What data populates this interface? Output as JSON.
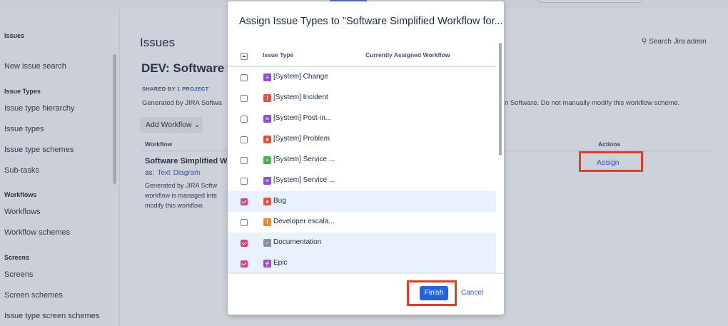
{
  "sidebar": {
    "items": [
      {
        "label": "Issues",
        "header": true
      },
      {
        "label": "New issue search",
        "header": false
      },
      {
        "label": "Issue Types",
        "header": true
      },
      {
        "label": "Issue type hierarchy",
        "header": false
      },
      {
        "label": "Issue types",
        "header": false
      },
      {
        "label": "Issue type schemes",
        "header": false
      },
      {
        "label": "Sub-tasks",
        "header": false
      },
      {
        "label": "Workflows",
        "header": true
      },
      {
        "label": "Workflows",
        "header": false
      },
      {
        "label": "Workflow schemes",
        "header": false
      },
      {
        "label": "Screens",
        "header": true
      },
      {
        "label": "Screens",
        "header": false
      },
      {
        "label": "Screen schemes",
        "header": false
      },
      {
        "label": "Issue type screen schemes",
        "header": false
      }
    ]
  },
  "header": {
    "title": "Issues",
    "search_admin": "Search Jira admin"
  },
  "scheme": {
    "title": "DEV: Software S",
    "shared_prefix": "SHARED BY ",
    "shared_link": "1 PROJECT",
    "description_left": "Generated by JIRA Softwa",
    "description_right": "n Software. Do not manually modify this workflow scheme.",
    "add_workflow": "Add Workflow",
    "add_workflow_chevron": "⌄",
    "col_workflow": "Workflow",
    "col_actions": "Actions",
    "workflow_name": "Software Simplified W",
    "as_label": "as:",
    "text_link": "Text",
    "diagram_link": "Diagram",
    "workflow_desc_lines": [
      "Generated by JIRA Softw",
      "workflow is managed inte",
      "modify this workflow."
    ],
    "assign_link": "Assign"
  },
  "modal": {
    "title": "Assign Issue Types to \"Software Simplified Workflow for...",
    "col_issue_type": "Issue Type",
    "col_assigned": "Currently Assigned Workflow",
    "finish": "Finish",
    "cancel": "Cancel",
    "rows": [
      {
        "label": "[System] Change",
        "checked": false,
        "icon_color": "#8f4ed6",
        "icon": "change-icon",
        "glyph": "≡"
      },
      {
        "label": "[System] Incident",
        "checked": false,
        "icon_color": "#e0533a",
        "icon": "incident-icon",
        "glyph": "!"
      },
      {
        "label": "[System] Post-in...",
        "checked": false,
        "icon_color": "#8f4ed6",
        "icon": "post-incident-icon",
        "glyph": "≡"
      },
      {
        "label": "[System] Problem",
        "checked": false,
        "icon_color": "#e0533a",
        "icon": "problem-icon",
        "glyph": "●"
      },
      {
        "label": "[System] Service ...",
        "checked": false,
        "icon_color": "#4bb44f",
        "icon": "service-request-icon",
        "glyph": "▪"
      },
      {
        "label": "[System] Service ...",
        "checked": false,
        "icon_color": "#8f4ed6",
        "icon": "service-request-approvals-icon",
        "glyph": "≡"
      },
      {
        "label": "Bug",
        "checked": true,
        "icon_color": "#e0533a",
        "icon": "bug-icon",
        "glyph": "●"
      },
      {
        "label": "Developer escala...",
        "checked": false,
        "icon_color": "#f08a24",
        "icon": "developer-escalation-icon",
        "glyph": "!"
      },
      {
        "label": "Documentation",
        "checked": true,
        "icon_color": "#8a8f9a",
        "icon": "documentation-icon",
        "glyph": "▫"
      },
      {
        "label": "Epic",
        "checked": true,
        "icon_color": "#8f4ed6",
        "icon": "epic-icon",
        "glyph": "⚡"
      }
    ]
  },
  "colors": {
    "accent": "#2463d8",
    "highlight": "#d9402b",
    "checked": "#d04775"
  }
}
